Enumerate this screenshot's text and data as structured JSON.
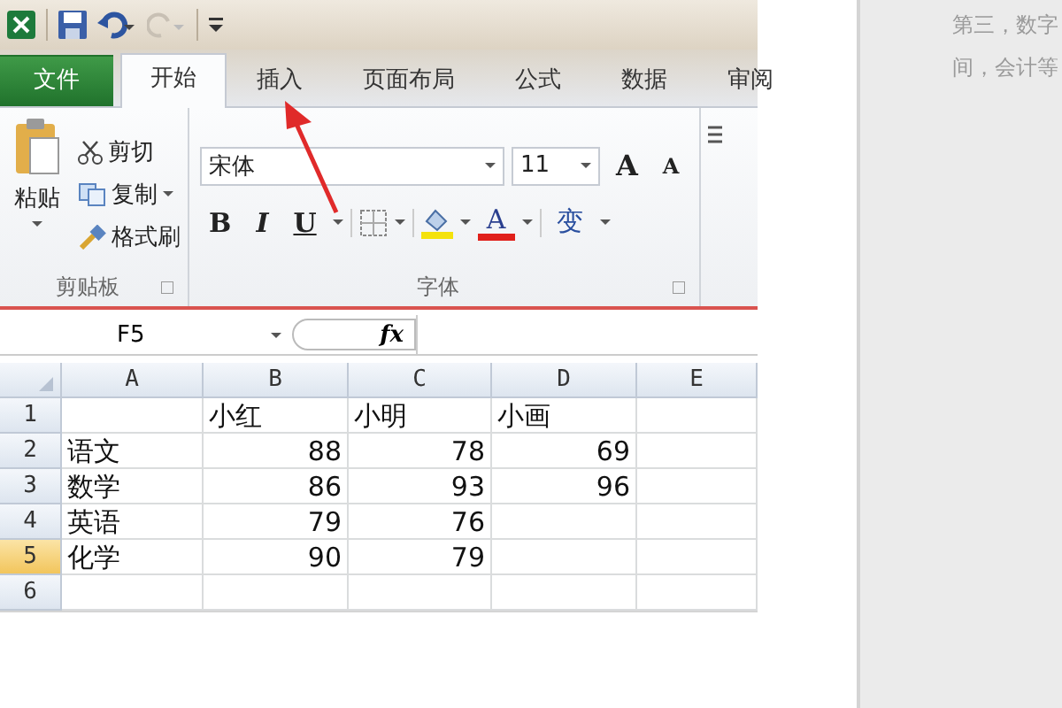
{
  "tabs": [
    {
      "label": "文件",
      "kind": "file",
      "selected": false
    },
    {
      "label": "开始",
      "kind": "tab",
      "selected": true
    },
    {
      "label": "插入",
      "kind": "tab",
      "selected": false
    },
    {
      "label": "页面布局",
      "kind": "tab",
      "selected": false
    },
    {
      "label": "公式",
      "kind": "tab",
      "selected": false
    },
    {
      "label": "数据",
      "kind": "tab",
      "selected": false
    },
    {
      "label": "审阅",
      "kind": "tab",
      "selected": false
    }
  ],
  "clipboard": {
    "paste": "粘贴",
    "cut": "剪切",
    "copy": "复制",
    "format_painter": "格式刷",
    "group_label": "剪贴板"
  },
  "font": {
    "font_name": "宋体",
    "font_size": "11",
    "grow": "A",
    "shrink": "A",
    "bold": "B",
    "italic": "I",
    "underline": "U",
    "color_letter": "A",
    "phonetic": "变",
    "group_label": "字体"
  },
  "formula_bar": {
    "name_box": "F5",
    "function_label": "fx"
  },
  "grid": {
    "columns": [
      "A",
      "B",
      "C",
      "D",
      "E"
    ],
    "rows": [
      {
        "header": "1",
        "selected": false,
        "cells": [
          null,
          {
            "text": "小红",
            "kind": "text"
          },
          {
            "text": "小明",
            "kind": "text"
          },
          {
            "text": "小画",
            "kind": "text"
          },
          null
        ]
      },
      {
        "header": "2",
        "selected": false,
        "cells": [
          {
            "text": "语文",
            "kind": "text"
          },
          {
            "text": "88",
            "kind": "number"
          },
          {
            "text": "78",
            "kind": "number"
          },
          {
            "text": "69",
            "kind": "number"
          },
          null
        ]
      },
      {
        "header": "3",
        "selected": false,
        "cells": [
          {
            "text": "数学",
            "kind": "text"
          },
          {
            "text": "86",
            "kind": "number"
          },
          {
            "text": "93",
            "kind": "number"
          },
          {
            "text": "96",
            "kind": "number"
          },
          null
        ]
      },
      {
        "header": "4",
        "selected": false,
        "cells": [
          {
            "text": "英语",
            "kind": "text"
          },
          {
            "text": "79",
            "kind": "number"
          },
          {
            "text": "76",
            "kind": "number"
          },
          null,
          null
        ]
      },
      {
        "header": "5",
        "selected": true,
        "cells": [
          {
            "text": "化学",
            "kind": "text"
          },
          {
            "text": "90",
            "kind": "number"
          },
          {
            "text": "79",
            "kind": "number"
          },
          null,
          null
        ]
      },
      {
        "header": "6",
        "selected": false
      }
    ]
  },
  "side_panel": {
    "lines": [
      "第三，数字",
      "间，会计等"
    ]
  }
}
